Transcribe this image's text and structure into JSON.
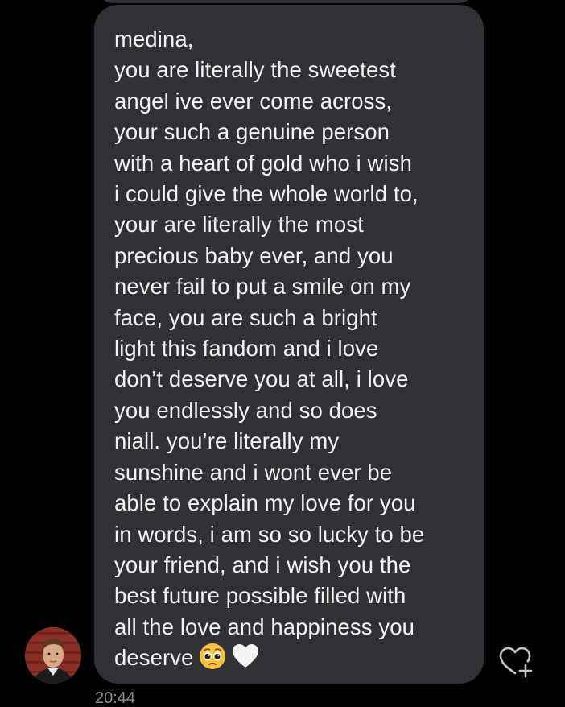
{
  "message": {
    "text": "medina,\nyou are literally the sweetest\nangel ive ever come across,\nyour such a genuine person\nwith a heart of gold who i wish\ni could give the whole world to,\nyour are literally the most\nprecious baby ever, and you\nnever fail to put a smile on my\nface, you are such a bright\nlight this fandom and i love\ndon’t deserve you at all, i love\nyou endlessly and so does\nniall. you’re literally my\nsunshine and i wont ever be\nable to explain my love for you\nin words, i am so so lucky to be\nyour friend, and i wish you the\nbest future possible filled with\nall the love and happiness you\ndeserve",
    "emojis": [
      "pleading-face-icon",
      "white-heart-icon"
    ],
    "timestamp": "20:44"
  },
  "colors": {
    "background": "#000000",
    "bubble": "#2f3134",
    "text": "#f2f2f2",
    "timestamp": "#8e8e93",
    "icon": "#c7c7cc"
  },
  "icons": {
    "avatar": "sender-avatar",
    "react": "heart-plus-icon"
  }
}
